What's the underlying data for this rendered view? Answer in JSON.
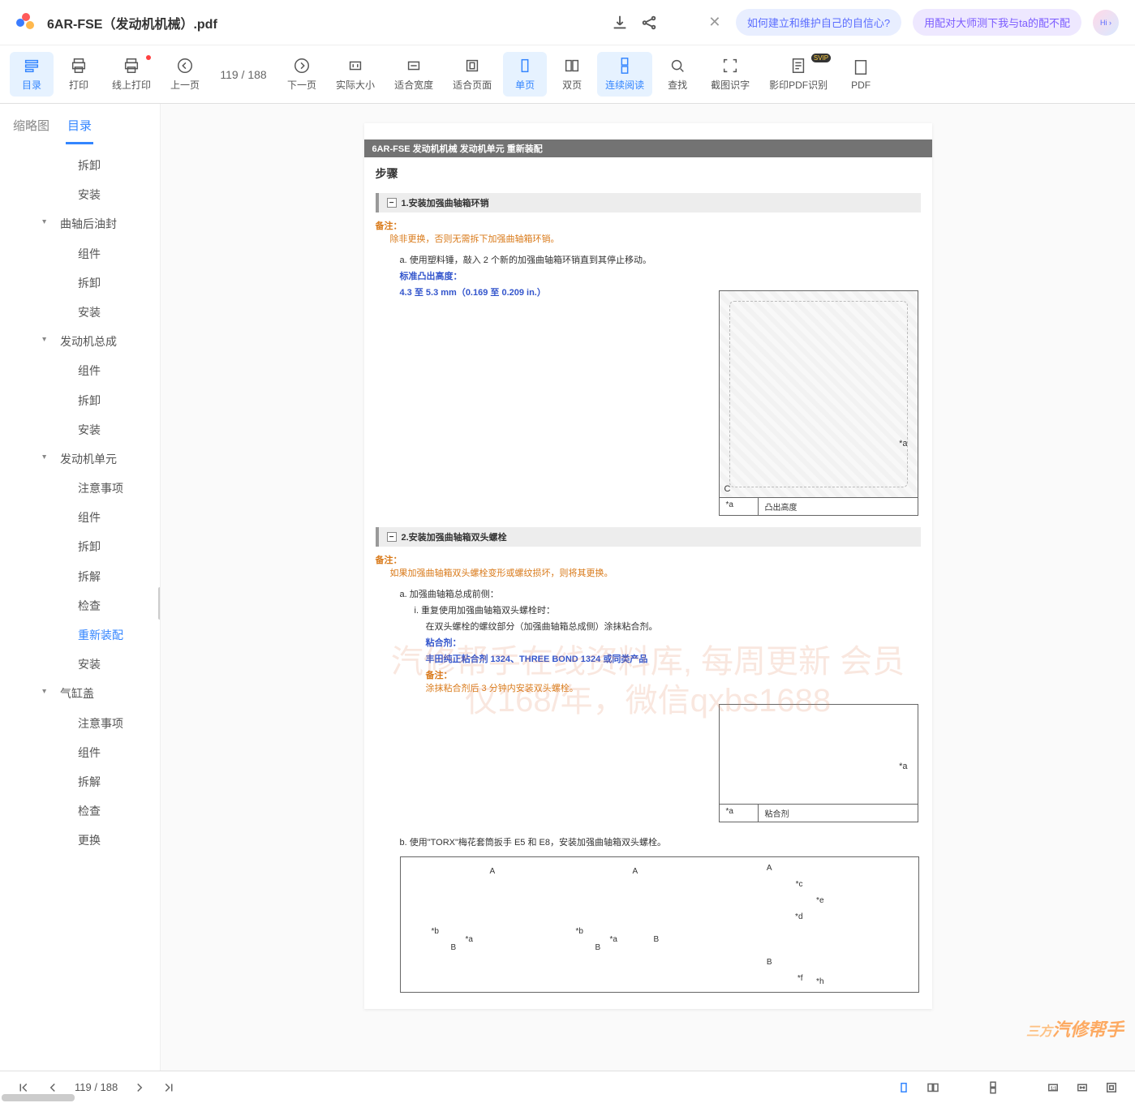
{
  "title": "6AR-FSE（发动机机械）.pdf",
  "chips": [
    "如何建立和维护自己的自信心?",
    "用配对大师测下我与ta的配不配"
  ],
  "avatar_text": "Hi ›",
  "toolbar": [
    {
      "id": "toc",
      "label": "目录",
      "active": true
    },
    {
      "id": "print",
      "label": "打印"
    },
    {
      "id": "online-print",
      "label": "线上打印",
      "dot": true
    },
    {
      "id": "prev",
      "label": "上一页"
    },
    {
      "id": "pageind",
      "label": "119 / 188",
      "kind": "text"
    },
    {
      "id": "next",
      "label": "下一页"
    },
    {
      "id": "actual",
      "label": "实际大小"
    },
    {
      "id": "fitw",
      "label": "适合宽度"
    },
    {
      "id": "fitp",
      "label": "适合页面"
    },
    {
      "id": "single",
      "label": "单页",
      "accent": true
    },
    {
      "id": "double",
      "label": "双页"
    },
    {
      "id": "cont",
      "label": "连续阅读",
      "accent": true
    },
    {
      "id": "find",
      "label": "查找"
    },
    {
      "id": "ocr-crop",
      "label": "截图识字"
    },
    {
      "id": "ocr-pdf",
      "label": "影印PDF识别",
      "badge": "SVIP"
    },
    {
      "id": "pdf",
      "label": "PDF"
    }
  ],
  "sidebar_tabs": [
    "缩略图",
    "目录"
  ],
  "active_tab": 1,
  "tree": [
    {
      "lvl": 2,
      "label": "拆卸"
    },
    {
      "lvl": 2,
      "label": "安装"
    },
    {
      "lvl": 1,
      "label": "曲轴后油封"
    },
    {
      "lvl": 2,
      "label": "组件"
    },
    {
      "lvl": 2,
      "label": "拆卸"
    },
    {
      "lvl": 2,
      "label": "安装"
    },
    {
      "lvl": 1,
      "label": "发动机总成"
    },
    {
      "lvl": 2,
      "label": "组件"
    },
    {
      "lvl": 2,
      "label": "拆卸"
    },
    {
      "lvl": 2,
      "label": "安装"
    },
    {
      "lvl": 1,
      "label": "发动机单元"
    },
    {
      "lvl": 2,
      "label": "注意事项"
    },
    {
      "lvl": 2,
      "label": "组件"
    },
    {
      "lvl": 2,
      "label": "拆卸"
    },
    {
      "lvl": 2,
      "label": "拆解"
    },
    {
      "lvl": 2,
      "label": "检查"
    },
    {
      "lvl": 2,
      "label": "重新装配",
      "active": true
    },
    {
      "lvl": 2,
      "label": "安装"
    },
    {
      "lvl": 1,
      "label": "气缸盖"
    },
    {
      "lvl": 2,
      "label": "注意事项"
    },
    {
      "lvl": 2,
      "label": "组件"
    },
    {
      "lvl": 2,
      "label": "拆解"
    },
    {
      "lvl": 2,
      "label": "检查"
    },
    {
      "lvl": 2,
      "label": "更换"
    }
  ],
  "page": {
    "header": "6AR-FSE 发动机机械   发动机单元   重新装配",
    "steps_label": "步骤",
    "s1": {
      "title": "1.安装加强曲轴箱环销",
      "note_hd": "备注：",
      "note": "除非更换，否则无需拆下加强曲轴箱环销。",
      "a": "a.    使用塑料锤，敲入 2 个新的加强曲轴箱环销直到其停止移动。",
      "a2": "标准凸出高度：",
      "a3": "4.3 至 5.3 mm（0.169 至 0.209 in.）",
      "cap_key": "*a",
      "cap_val": "凸出高度",
      "fig_c": "C"
    },
    "s2": {
      "title": "2.安装加强曲轴箱双头螺栓",
      "note_hd": "备注：",
      "note": "如果加强曲轴箱双头螺栓变形或螺纹损坏，则将其更换。",
      "a": "a.    加强曲轴箱总成前侧：",
      "i": "i.    重复使用加强曲轴箱双头螺栓时：",
      "i2": "在双头螺栓的螺纹部分（加强曲轴箱总成侧）涂抹粘合剂。",
      "bond_hd": "粘合剂：",
      "bond": "丰田纯正粘合剂 1324、THREE BOND 1324 或同类产品",
      "note2_hd": "备注：",
      "note2": "涂抹粘合剂后 3 分钟内安装双头螺栓。",
      "cap_key": "*a",
      "cap_val": "粘合剂",
      "b": "b.   使用\"TORX\"梅花套筒扳手 E5 和 E8，安装加强曲轴箱双头螺栓。"
    }
  },
  "watermark": "汽修帮手在线资料库, 每周更新  会员仅168/年，微信qxbs1688",
  "brand": "汽修帮手",
  "bottom_page": "119 / 188"
}
